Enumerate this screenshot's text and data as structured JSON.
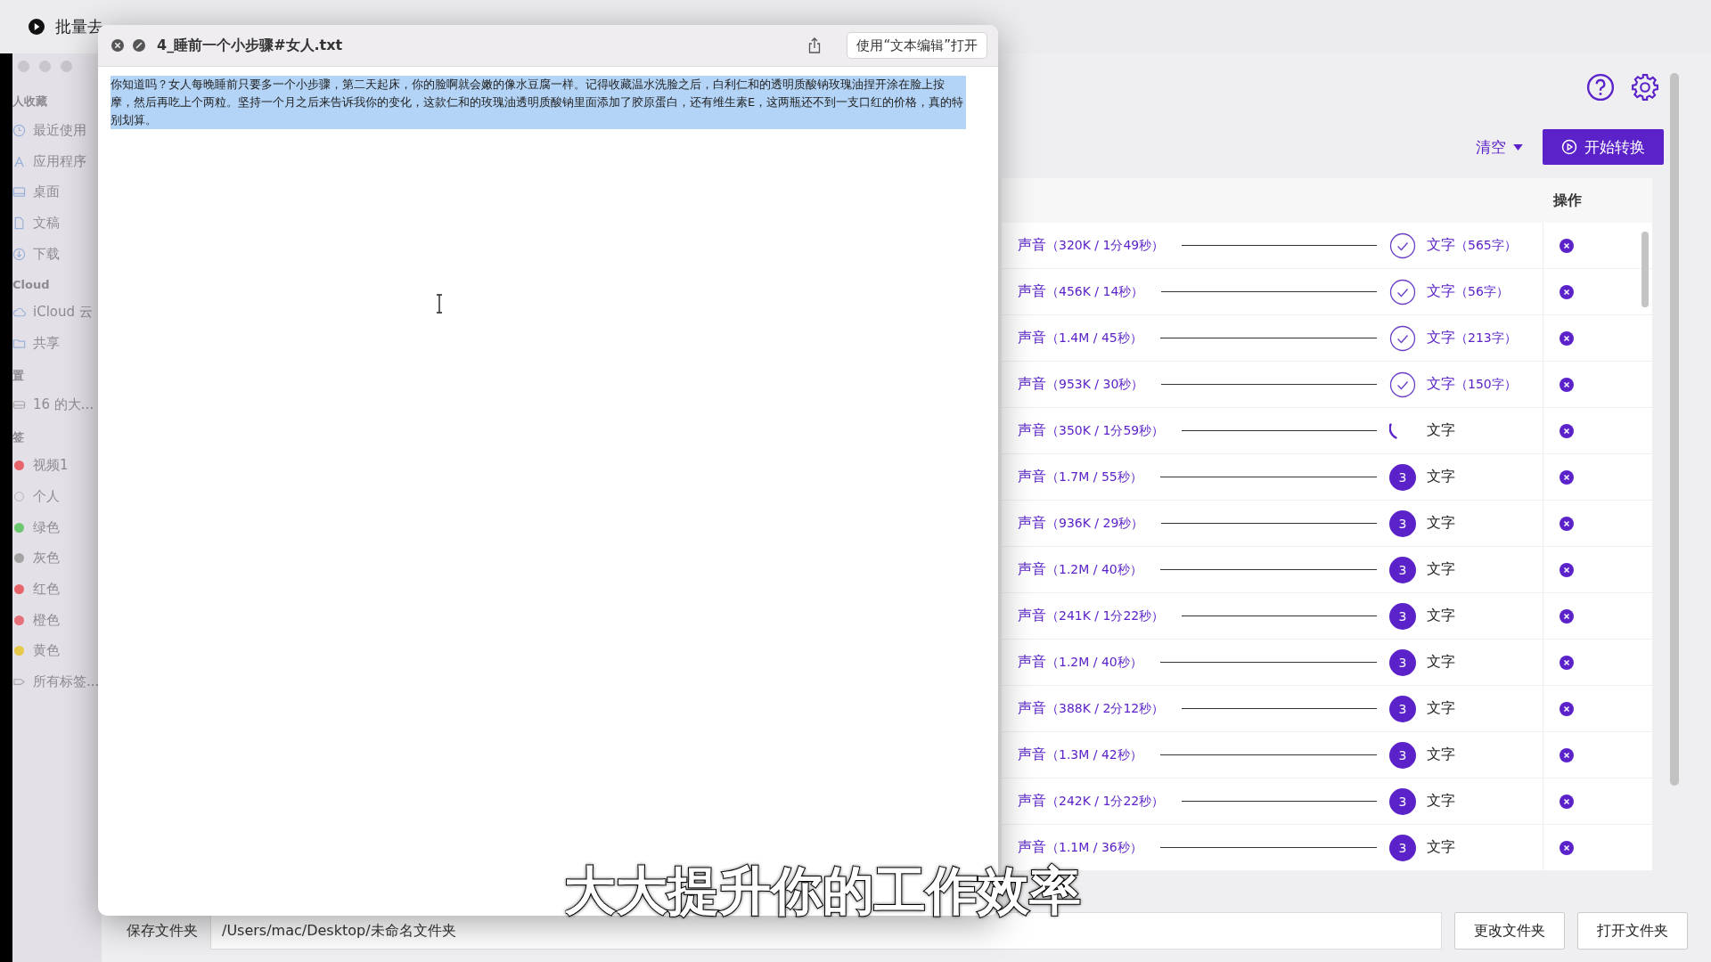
{
  "top_tab": {
    "label": "批量去"
  },
  "finder_sidebar": {
    "sections": [
      {
        "header": "人收藏",
        "items": [
          {
            "label": "最近使用",
            "kind": "clock"
          },
          {
            "label": "应用程序",
            "kind": "apps"
          },
          {
            "label": "桌面",
            "kind": "desktop"
          },
          {
            "label": "文稿",
            "kind": "doc"
          },
          {
            "label": "下载",
            "kind": "download"
          }
        ]
      },
      {
        "header": "Cloud",
        "items": [
          {
            "label": "iCloud 云",
            "kind": "cloud"
          },
          {
            "label": "共享",
            "kind": "folder"
          }
        ]
      },
      {
        "header": "置",
        "items": [
          {
            "label": "16 的大...",
            "kind": "disk"
          }
        ]
      },
      {
        "header": "签",
        "items": [
          {
            "label": "视频1",
            "kind": "tag",
            "color": "#e8646b"
          },
          {
            "label": "个人",
            "kind": "tag-empty"
          },
          {
            "label": "绿色",
            "kind": "tag",
            "color": "#6cc86e"
          },
          {
            "label": "灰色",
            "kind": "tag",
            "color": "#a3a3a3"
          },
          {
            "label": "红色",
            "kind": "tag",
            "color": "#e8646b"
          },
          {
            "label": "橙色",
            "kind": "tag",
            "color": "#e8707a"
          },
          {
            "label": "黄色",
            "kind": "tag",
            "color": "#e6c84a"
          },
          {
            "label": "所有标签...",
            "kind": "all-tags"
          }
        ]
      }
    ]
  },
  "preview": {
    "title": "4_睡前一个小步骤#女人.txt",
    "open_button": "使用“文本编辑”打开",
    "text": "你知道吗？女人每晚睡前只要多一个小步骤，第二天起床，你的脸啊就会嫩的像水豆腐一样。记得收藏温水洗脸之后，白利仁和的透明质酸钠玫瑰油捏开涂在脸上按摩，然后再吃上个两粒。坚持一个月之后来告诉我你的变化，这款仁和的玫瑰油透明质酸钠里面添加了胶原蛋白，还有维生素E，这两瓶还不到一支口红的价格，真的特别划算。",
    "text_selected": true
  },
  "clear_menu": "清空",
  "start_button": "开始转换",
  "table": {
    "columns": [
      "操作"
    ],
    "rows": [
      {
        "audio": "声音",
        "info": "（320K / 1分49秒）",
        "kind": "done",
        "text": "文字",
        "count": "（565字）"
      },
      {
        "audio": "声音",
        "info": "（456K / 14秒）",
        "kind": "done",
        "text": "文字",
        "count": "（56字）"
      },
      {
        "audio": "声音",
        "info": "（1.4M / 45秒）",
        "kind": "done",
        "text": "文字",
        "count": "（213字）"
      },
      {
        "audio": "声音",
        "info": "（953K / 30秒）",
        "kind": "done",
        "text": "文字",
        "count": "（150字）"
      },
      {
        "audio": "声音",
        "info": "（350K / 1分59秒）",
        "kind": "converting",
        "text": "文字"
      },
      {
        "audio": "声音",
        "info": "（1.7M / 55秒）",
        "kind": "queued",
        "badge": "3",
        "text": "文字"
      },
      {
        "audio": "声音",
        "info": "（936K / 29秒）",
        "kind": "queued",
        "badge": "3",
        "text": "文字"
      },
      {
        "audio": "声音",
        "info": "（1.2M / 40秒）",
        "kind": "queued",
        "badge": "3",
        "text": "文字"
      },
      {
        "audio": "声音",
        "info": "（241K / 1分22秒）",
        "kind": "queued",
        "badge": "3",
        "text": "文字"
      },
      {
        "audio": "声音",
        "info": "（1.2M / 40秒）",
        "kind": "queued",
        "badge": "3",
        "text": "文字"
      },
      {
        "audio": "声音",
        "info": "（388K / 2分12秒）",
        "kind": "queued",
        "badge": "3",
        "text": "文字"
      },
      {
        "audio": "声音",
        "info": "（1.3M / 42秒）",
        "kind": "queued",
        "badge": "3",
        "text": "文字"
      },
      {
        "audio": "声音",
        "info": "（242K / 1分22秒）",
        "kind": "queued",
        "badge": "3",
        "text": "文字"
      },
      {
        "audio": "声音",
        "info": "（1.1M / 36秒）",
        "kind": "queued",
        "badge": "3",
        "text": "文字"
      }
    ]
  },
  "bottom_bar": {
    "save_label": "保存文件夹",
    "path": "/Users/mac/Desktop/未命名文件夹",
    "buttons": [
      "更改文件夹",
      "打开文件夹"
    ]
  },
  "subtitle": "大大提升你的工作效率"
}
